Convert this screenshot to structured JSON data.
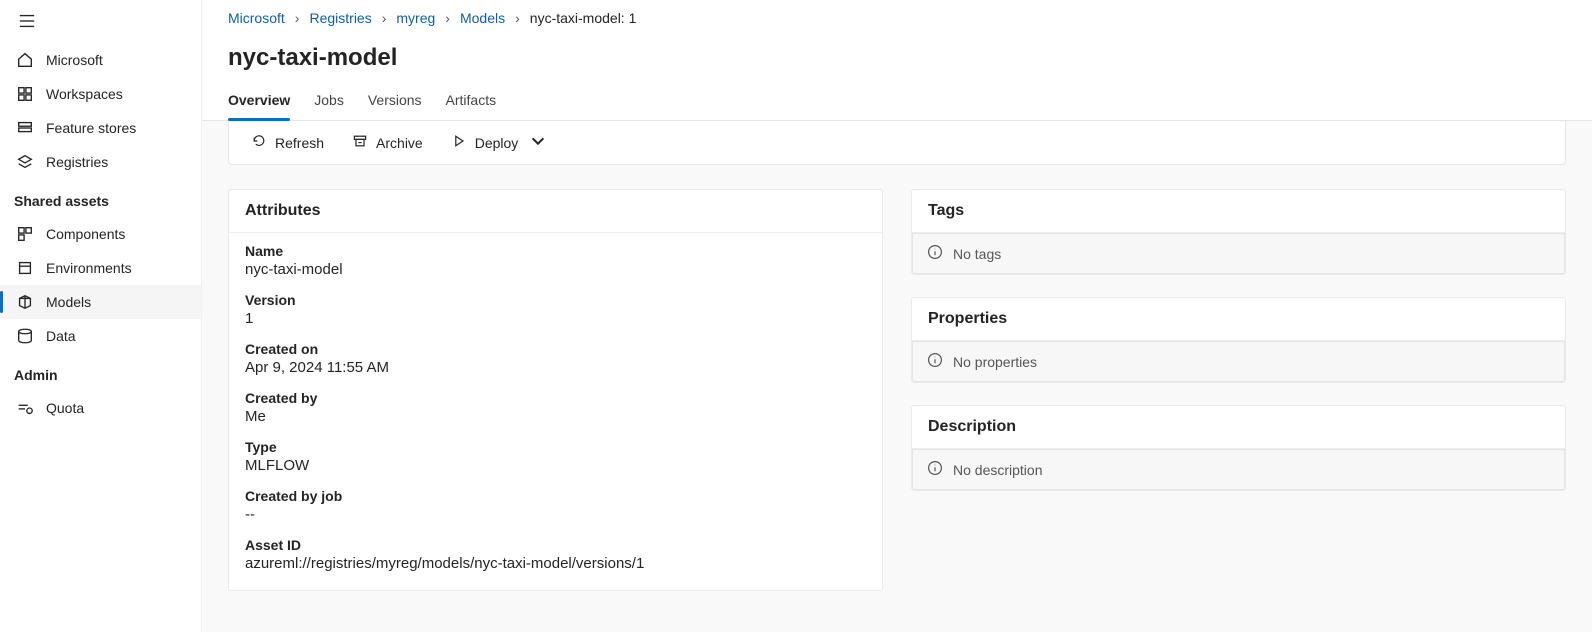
{
  "sidebar": {
    "items": [
      {
        "label": "Microsoft"
      },
      {
        "label": "Workspaces"
      },
      {
        "label": "Feature stores"
      },
      {
        "label": "Registries"
      }
    ],
    "shared_label": "Shared assets",
    "shared_items": [
      {
        "label": "Components"
      },
      {
        "label": "Environments"
      },
      {
        "label": "Models"
      },
      {
        "label": "Data"
      }
    ],
    "admin_label": "Admin",
    "admin_items": [
      {
        "label": "Quota"
      }
    ]
  },
  "breadcrumb": {
    "items": [
      {
        "label": "Microsoft",
        "link": true
      },
      {
        "label": "Registries",
        "link": true
      },
      {
        "label": "myreg",
        "link": true
      },
      {
        "label": "Models",
        "link": true
      },
      {
        "label": "nyc-taxi-model: 1",
        "link": false
      }
    ]
  },
  "page": {
    "title": "nyc-taxi-model"
  },
  "tabs": [
    {
      "label": "Overview",
      "active": true
    },
    {
      "label": "Jobs",
      "active": false
    },
    {
      "label": "Versions",
      "active": false
    },
    {
      "label": "Artifacts",
      "active": false
    }
  ],
  "toolbar": {
    "refresh": "Refresh",
    "archive": "Archive",
    "deploy": "Deploy"
  },
  "attributes": {
    "header": "Attributes",
    "items": {
      "name": {
        "label": "Name",
        "value": "nyc-taxi-model"
      },
      "version": {
        "label": "Version",
        "value": "1"
      },
      "created_on": {
        "label": "Created on",
        "value": "Apr 9, 2024 11:55 AM"
      },
      "created_by": {
        "label": "Created by",
        "value": "Me"
      },
      "type": {
        "label": "Type",
        "value": "MLFLOW"
      },
      "created_by_job": {
        "label": "Created by job",
        "value": "--"
      },
      "asset_id": {
        "label": "Asset ID",
        "value": "azureml://registries/myreg/models/nyc-taxi-model/versions/1"
      }
    }
  },
  "panels": {
    "tags": {
      "header": "Tags",
      "empty": "No tags"
    },
    "properties": {
      "header": "Properties",
      "empty": "No properties"
    },
    "description": {
      "header": "Description",
      "empty": "No description"
    }
  }
}
